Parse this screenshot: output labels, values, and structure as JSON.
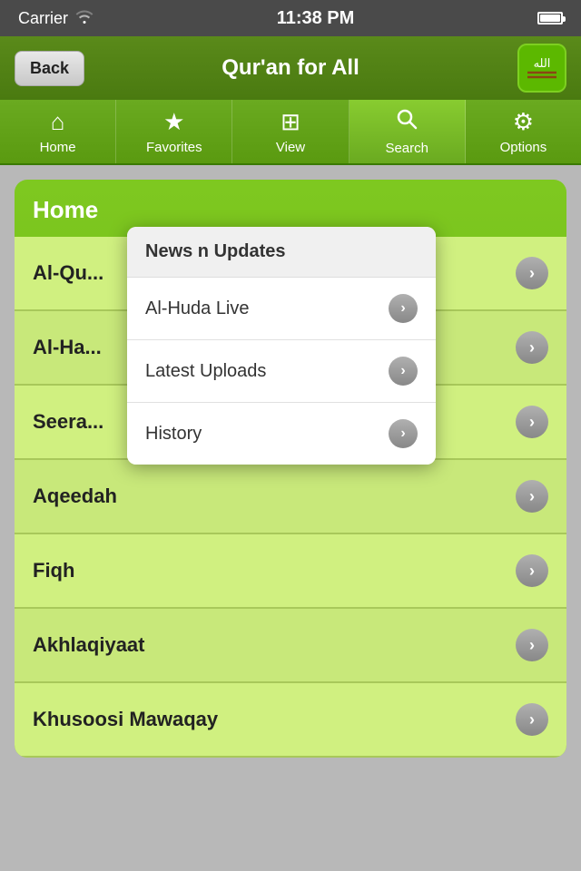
{
  "statusBar": {
    "carrier": "Carrier",
    "time": "11:38 PM",
    "batteryLabel": "Battery"
  },
  "navBar": {
    "backLabel": "Back",
    "title": "Qur'an for All",
    "logoSymbol": "الله"
  },
  "tabs": [
    {
      "id": "home",
      "label": "Home",
      "icon": "⌂",
      "active": false
    },
    {
      "id": "favorites",
      "label": "Favorites",
      "icon": "★",
      "active": false
    },
    {
      "id": "view",
      "label": "View",
      "icon": "⊞",
      "active": false
    },
    {
      "id": "search",
      "label": "Search",
      "icon": "⚲",
      "active": true
    },
    {
      "id": "options",
      "label": "Options",
      "icon": "⚙",
      "active": false
    }
  ],
  "home": {
    "title": "Home",
    "listItems": [
      {
        "id": "al-quran",
        "label": "Al-Qu..."
      },
      {
        "id": "al-hadith",
        "label": "Al-Ha..."
      },
      {
        "id": "seerah",
        "label": "Seera..."
      },
      {
        "id": "aqeedah",
        "label": "Aqeedah"
      },
      {
        "id": "fiqh",
        "label": "Fiqh"
      },
      {
        "id": "akhlaqiyaat",
        "label": "Akhlaqiyaat"
      },
      {
        "id": "khusoosi",
        "label": "Khusoosi Mawaqay"
      }
    ]
  },
  "dropdown": {
    "header": "News n Updates",
    "items": [
      {
        "id": "al-huda-live",
        "label": "Al-Huda Live",
        "hasChevron": true
      },
      {
        "id": "latest-uploads",
        "label": "Latest Uploads",
        "hasChevron": true
      },
      {
        "id": "history",
        "label": "History",
        "hasChevron": true
      }
    ]
  },
  "colors": {
    "accent": "#6aaa20",
    "accentDark": "#4a7a10",
    "listBg": "#c8e87a",
    "white": "#ffffff"
  }
}
